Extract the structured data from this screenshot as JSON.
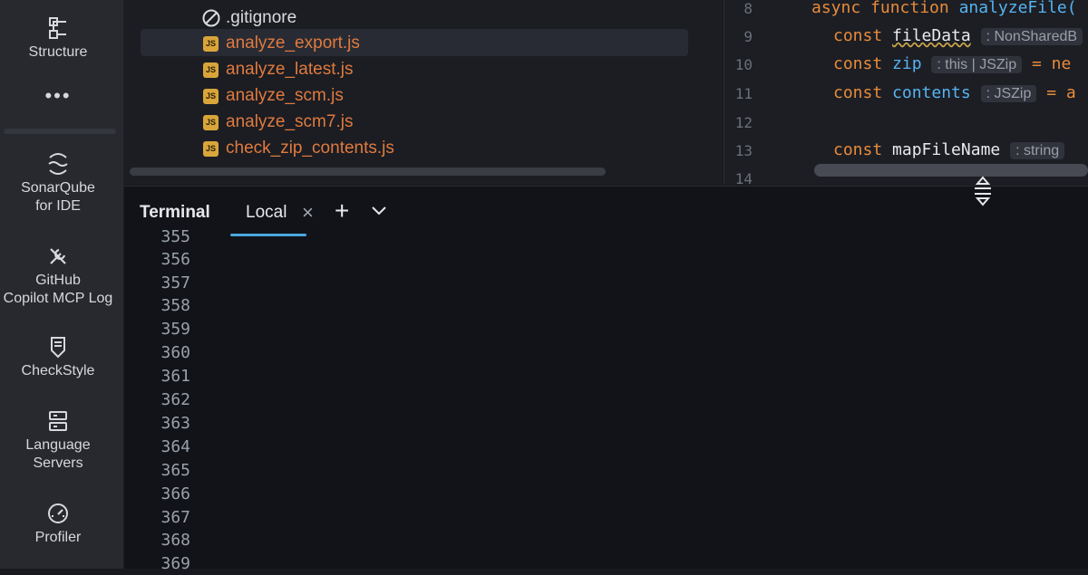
{
  "sidebar": {
    "items": [
      {
        "label": "Structure",
        "icon": "structure-icon"
      },
      {
        "label": "•••",
        "icon": "more-icon"
      },
      {
        "label": "SonarQube\nfor IDE",
        "line1": "SonarQube",
        "line2": "for IDE",
        "icon": "sonarqube-icon"
      },
      {
        "label": "GitHub Copilot MCP Log",
        "line1": "GitHub",
        "line2": "Copilot MCP Log",
        "icon": "tools-icon"
      },
      {
        "label": "CheckStyle",
        "icon": "checkstyle-icon"
      },
      {
        "label": "Language Servers",
        "line1": "Language",
        "line2": "Servers",
        "icon": "servers-icon"
      },
      {
        "label": "Profiler",
        "icon": "profiler-icon"
      }
    ]
  },
  "file_tree": {
    "files": [
      {
        "name": ".gitignore",
        "type": "ignore"
      },
      {
        "name": "analyze_export.js",
        "type": "js"
      },
      {
        "name": "analyze_latest.js",
        "type": "js"
      },
      {
        "name": "analyze_scm.js",
        "type": "js"
      },
      {
        "name": "analyze_scm7.js",
        "type": "js"
      },
      {
        "name": "check_zip_contents.js",
        "type": "js"
      }
    ],
    "js_badge": "JS"
  },
  "editor": {
    "line_numbers": [
      "8",
      "9",
      "10",
      "11",
      "12",
      "13",
      "14"
    ],
    "lines": {
      "l8_kw": "async function ",
      "l8_fn": "analyzeFile(",
      "l9_kw": "const ",
      "l9_var": "fileData",
      "l9_hint": ": NonSharedB",
      "l10_kw": "const ",
      "l10_var": "zip",
      "l10_hint": ": this | JSZip",
      "l10_rest": " = ne",
      "l11_kw": "const ",
      "l11_var": "contents",
      "l11_hint": ": JSZip",
      "l11_rest": " = a",
      "l13_kw": "const ",
      "l13_var": "mapFileName",
      "l13_hint": ": string"
    }
  },
  "terminal": {
    "title": "Terminal",
    "tab_label": "Local",
    "close_glyph": "×",
    "add_glyph": "+",
    "menu_glyph": "⌄",
    "line_numbers": [
      "355",
      "356",
      "357",
      "358",
      "359",
      "360",
      "361",
      "362",
      "363",
      "364",
      "365",
      "366",
      "367",
      "368",
      "369"
    ]
  },
  "colors": {
    "accent_tab": "#4aa9de",
    "keyword_pink": "#ee4fa5",
    "keyword_blue": "#5ec4ff",
    "string_yellow": "#e8b83c",
    "file_orange": "#e07a3f"
  }
}
